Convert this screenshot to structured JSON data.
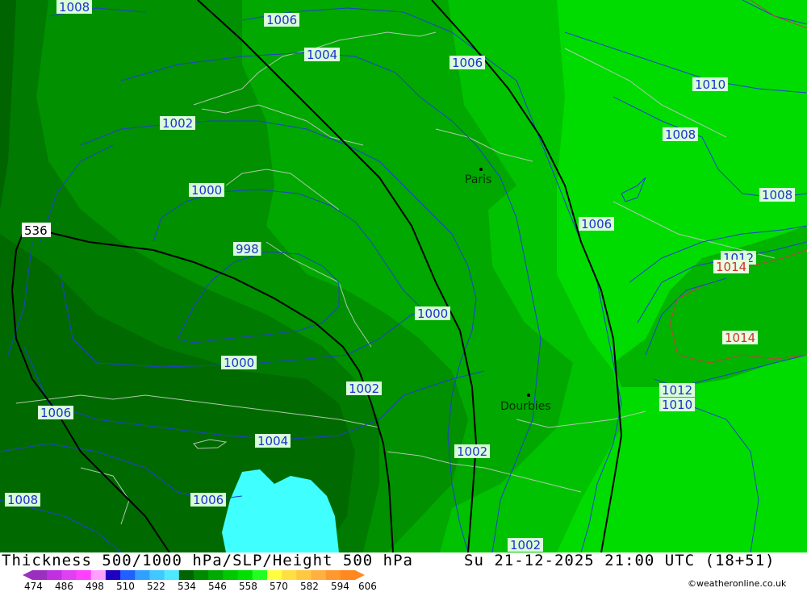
{
  "map": {
    "isobars": [
      {
        "value": "1008",
        "color": "blue"
      },
      {
        "value": "1006",
        "color": "blue"
      },
      {
        "value": "1004",
        "color": "blue"
      },
      {
        "value": "1006",
        "color": "blue"
      },
      {
        "value": "1010",
        "color": "blue"
      },
      {
        "value": "1002",
        "color": "blue"
      },
      {
        "value": "1008",
        "color": "blue"
      },
      {
        "value": "1000",
        "color": "blue"
      },
      {
        "value": "1008",
        "color": "blue"
      },
      {
        "value": "1006",
        "color": "blue"
      },
      {
        "value": "998",
        "color": "blue"
      },
      {
        "value": "1012",
        "color": "blue"
      },
      {
        "value": "1014",
        "color": "red"
      },
      {
        "value": "1000",
        "color": "blue"
      },
      {
        "value": "1014",
        "color": "red"
      },
      {
        "value": "1000",
        "color": "blue"
      },
      {
        "value": "1002",
        "color": "blue"
      },
      {
        "value": "1012",
        "color": "blue"
      },
      {
        "value": "1010",
        "color": "blue"
      },
      {
        "value": "1006",
        "color": "blue"
      },
      {
        "value": "1004",
        "color": "blue"
      },
      {
        "value": "1002",
        "color": "blue"
      },
      {
        "value": "1008",
        "color": "blue"
      },
      {
        "value": "1006",
        "color": "blue"
      },
      {
        "value": "1002",
        "color": "blue"
      }
    ],
    "thickness_label": "536",
    "cities": [
      "Paris",
      "Dourbies"
    ],
    "shading_colors": [
      "#006400",
      "#008200",
      "#00a000",
      "#00c200",
      "#00dc00",
      "#40ffff"
    ]
  },
  "footer": {
    "title": "Thickness 500/1000 hPa/SLP/Height 500 hPa",
    "datetime": "Su 21-12-2025 21:00 UTC (18+51)",
    "legend_ticks": [
      "474",
      "486",
      "498",
      "510",
      "522",
      "534",
      "546",
      "558",
      "570",
      "582",
      "594",
      "606"
    ],
    "legend_colors": [
      "#9b30c0",
      "#c030e0",
      "#e040f0",
      "#ff40ff",
      "#ffa0ff",
      "#2000c0",
      "#2060ff",
      "#30a0ff",
      "#40c8ff",
      "#50e8ff",
      "#006400",
      "#008a00",
      "#00aa00",
      "#00c800",
      "#00e000",
      "#20ff20",
      "#ffff40",
      "#ffe040",
      "#ffc840",
      "#ffb040",
      "#ff9830",
      "#ff8820"
    ],
    "credit": "©weatheronline.co.uk"
  }
}
